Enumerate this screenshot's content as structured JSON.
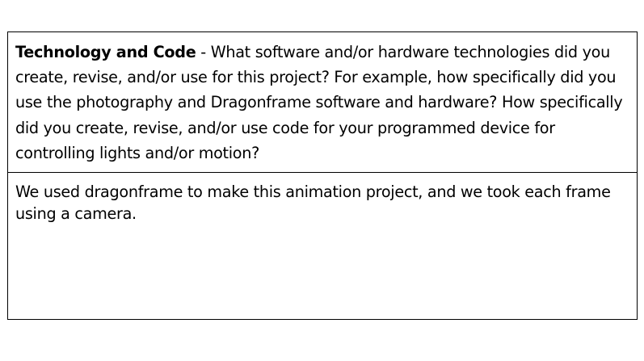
{
  "prompt": {
    "heading": "Technology and Code",
    "separator": " - ",
    "text": "What software and/or hardware technologies did you create, revise, and/or use for this project?  For example, how specifically did you use the photography and Dragonframe software and hardware?  How specifically did you create, revise, and/or use code for your programmed device for controlling lights and/or motion?"
  },
  "response": {
    "text": "We used dragonframe to make this animation project, and we took each frame using a camera."
  }
}
